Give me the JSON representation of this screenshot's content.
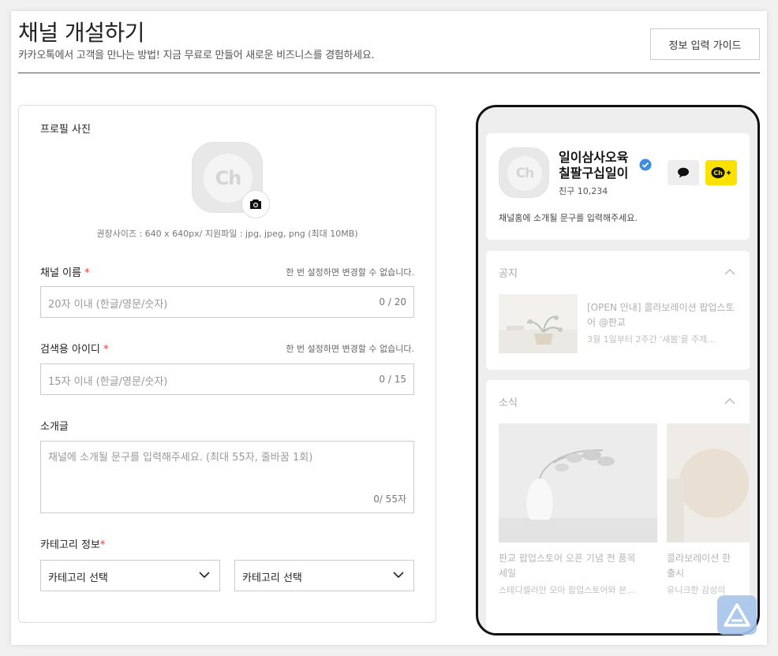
{
  "header": {
    "title": "채널 개설하기",
    "subtitle": "카카오톡에서 고객을 만나는 방법! 지금 무료로 만들어 새로운 비즈니스를 경험하세요.",
    "guide_button": "정보 입력 가이드"
  },
  "form": {
    "profile": {
      "label": "프로필 사진",
      "avatar_text": "Ch",
      "hint": "권장사이즈 : 640 x 640px/ 지원파일 : jpg, jpeg, png (최대 10MB)"
    },
    "channel_name": {
      "label": "채널 이름",
      "required": "*",
      "note": "한 번 설정하면 변경할 수 없습니다.",
      "placeholder": "20자 이내 (한글/영문/숫자)",
      "counter": "0 / 20"
    },
    "search_id": {
      "label": "검색용 아이디",
      "required": "*",
      "note": "한 번 설정하면 변경할 수 없습니다.",
      "placeholder": "15자 이내 (한글/영문/숫자)",
      "counter": "0 / 15"
    },
    "intro": {
      "label": "소개글",
      "placeholder": "채널에 소개될 문구를 입력해주세요. (최대 55자, 줄바꿈 1회)",
      "counter": "0/ 55자"
    },
    "category": {
      "label": "카테고리 정보",
      "required": "*",
      "select1": "카테고리 선택",
      "select2": "카테고리 선택"
    }
  },
  "preview": {
    "avatar_text": "Ch",
    "name_line1": "일이삼사오육",
    "name_line2": "칠팔구십일이",
    "friends": "친구 10,234",
    "description": "채널홈에 소개될 문구를 입력해주세요.",
    "add_label": "Ch+",
    "notice": {
      "title": "공지",
      "item_title": "[OPEN 안내] 콜라보레이션 팝업스토어 @판교",
      "item_sub": "3월 1일부터 2주간 '새봄'을 주제..."
    },
    "news": {
      "title": "소식",
      "items": [
        {
          "title_line1": "판교 팝업스토어 오픈 기념 전 품목",
          "title_line2": "세일",
          "sub": "스테디셀러만 모아 팝업스토어와 본..."
        },
        {
          "title_line1": "콜라보레이션 한",
          "title_line2": "출시",
          "sub": "유니크한 감성의"
        }
      ]
    }
  },
  "colors": {
    "required": "#e53935",
    "kakao_yellow": "#fae100",
    "verified_blue": "#3b8ee0"
  },
  "icons": [
    "camera-icon",
    "chevron-down-icon",
    "chevron-up-icon",
    "chat-bubble-icon",
    "verified-badge-icon",
    "floating-assistant-icon"
  ]
}
